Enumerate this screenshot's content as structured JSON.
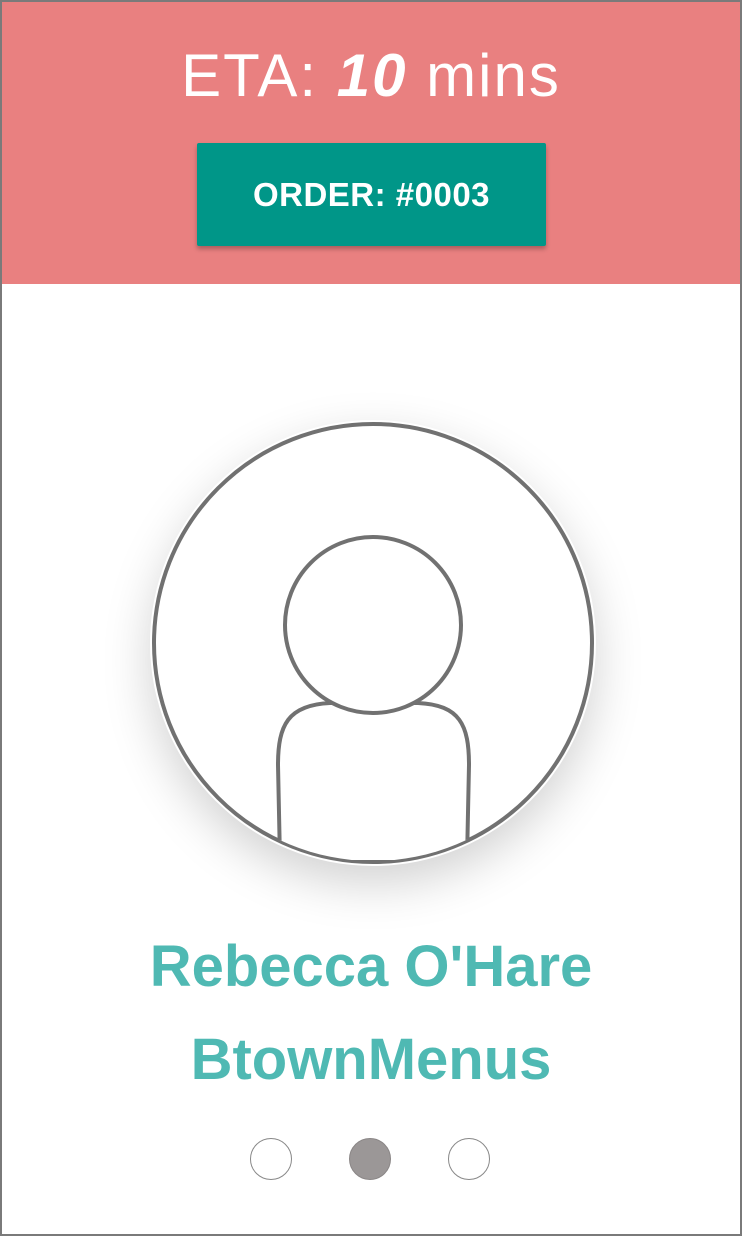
{
  "header": {
    "eta_prefix": "ETA: ",
    "eta_value": "10",
    "eta_suffix": " mins",
    "order_label": "ORDER: #0003",
    "background_color": "#e98080",
    "button_color": "#009688"
  },
  "profile": {
    "avatar_icon": "user-placeholder-icon",
    "name": "Rebecca O'Hare",
    "organization": "BtownMenus",
    "text_color": "#4fb9b3"
  },
  "pager": {
    "page_count": 3,
    "active_index": 1
  }
}
